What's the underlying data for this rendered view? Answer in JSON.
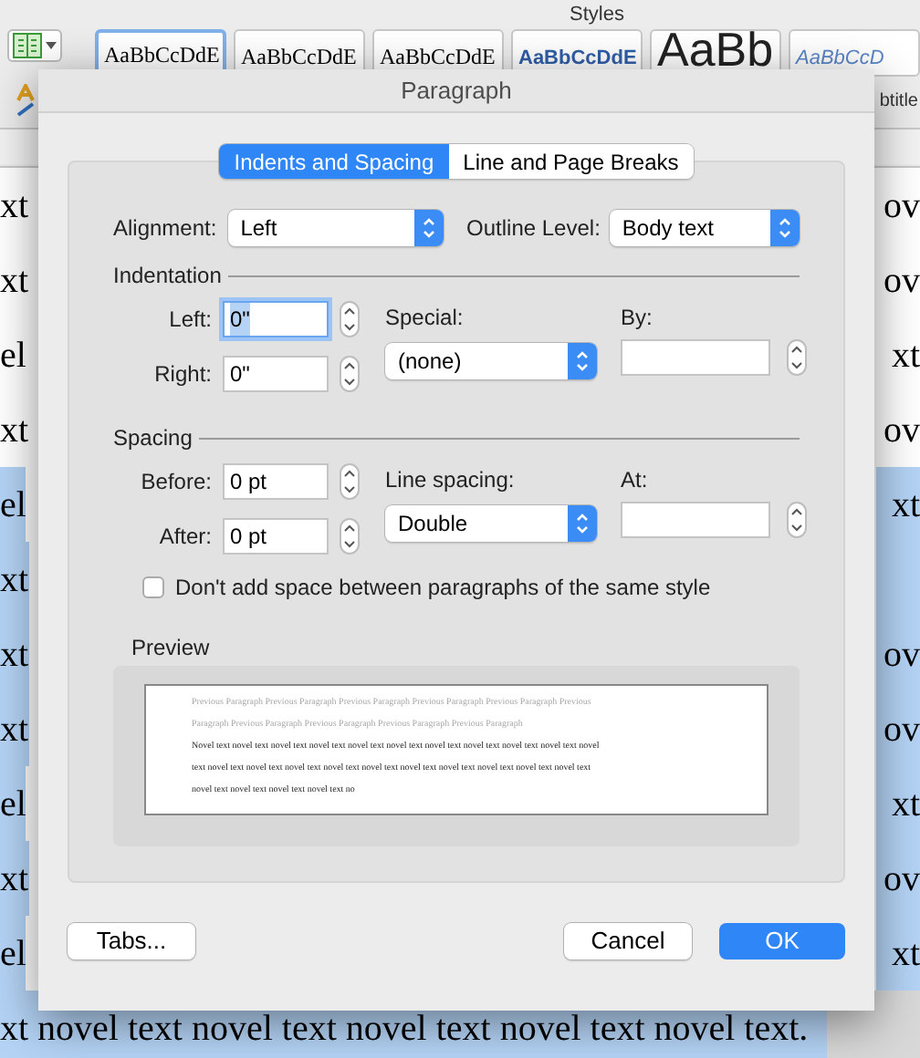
{
  "toolbar": {
    "styles_label": "Styles",
    "style_gallery": [
      {
        "sample": "AaBbCcDdE",
        "kind": "serif",
        "selected": true
      },
      {
        "sample": "AaBbCcDdE",
        "kind": "serif",
        "selected": false
      },
      {
        "sample": "AaBbCcDdE",
        "kind": "serif",
        "selected": false
      },
      {
        "sample": "AaBbCcDdE",
        "kind": "heading",
        "selected": false
      },
      {
        "sample": "AaBb",
        "kind": "title",
        "selected": false
      },
      {
        "sample": "AaBbCcD",
        "kind": "subtitle",
        "selected": false
      }
    ],
    "style_name_fragment": "btitle"
  },
  "document": {
    "lines": [
      {
        "left": "xt",
        "right": "ov",
        "highlighted": false
      },
      {
        "left": "xt",
        "right": "ov",
        "highlighted": false
      },
      {
        "left": "el",
        "right": "xt",
        "highlighted": false
      },
      {
        "left": "xt",
        "right": "ov",
        "highlighted": false
      },
      {
        "left": "el",
        "right": "xt",
        "highlighted": true
      },
      {
        "left": "xt",
        "highlighted": true
      },
      {
        "left": "xt",
        "right": "ov",
        "highlighted": true
      },
      {
        "left": "xt",
        "right": "ov",
        "highlighted": true
      },
      {
        "left": "el",
        "right": "xt",
        "highlighted": true
      },
      {
        "left": "xt",
        "right": "ov",
        "highlighted": true
      },
      {
        "left": "el",
        "right": "xt",
        "highlighted": true
      }
    ],
    "last_line": {
      "text": "xt novel text novel text novel text novel text novel text.",
      "highlighted": true
    }
  },
  "dialog": {
    "title": "Paragraph",
    "tabs": [
      {
        "label": "Indents and Spacing",
        "selected": true
      },
      {
        "label": "Line and Page Breaks",
        "selected": false
      }
    ],
    "alignment": {
      "label": "Alignment:",
      "value": "Left"
    },
    "outline_level": {
      "label": "Outline Level:",
      "value": "Body text"
    },
    "indentation": {
      "heading": "Indentation",
      "left": {
        "label": "Left:",
        "value": "0\"",
        "focused": true
      },
      "right": {
        "label": "Right:",
        "value": "0\"",
        "focused": false
      },
      "special": {
        "label": "Special:",
        "value": "(none)"
      },
      "by": {
        "label": "By:"
      }
    },
    "spacing": {
      "heading": "Spacing",
      "before": {
        "label": "Before:",
        "value": "0 pt",
        "focused": false
      },
      "after": {
        "label": "After:",
        "value": "0 pt",
        "focused": false
      },
      "line_spacing": {
        "label": "Line spacing:",
        "value": "Double"
      },
      "at": {
        "label": "At:"
      }
    },
    "same_style_checkbox": {
      "label": "Don't add space between paragraphs of the same style",
      "checked": false
    },
    "preview": {
      "heading": "Preview",
      "lines": [
        {
          "kind": "previous",
          "text": "Previous Paragraph Previous Paragraph Previous Paragraph Previous Paragraph Previous Paragraph Previous"
        },
        {
          "kind": "previous",
          "text": "Paragraph Previous Paragraph Previous Paragraph Previous Paragraph Previous Paragraph"
        },
        {
          "kind": "current",
          "text": "Novel text novel text novel text novel text novel text novel text novel text novel text novel text novel text novel"
        },
        {
          "kind": "current",
          "text": "text novel text novel text novel text novel text novel text novel text novel text novel text novel text novel text"
        },
        {
          "kind": "current",
          "text": "novel text novel text novel text novel text no"
        }
      ]
    },
    "buttons": [
      {
        "label": "Tabs...",
        "kind": "secondary"
      },
      {
        "label": "Cancel",
        "kind": "secondary"
      },
      {
        "label": "OK",
        "kind": "default"
      }
    ]
  }
}
